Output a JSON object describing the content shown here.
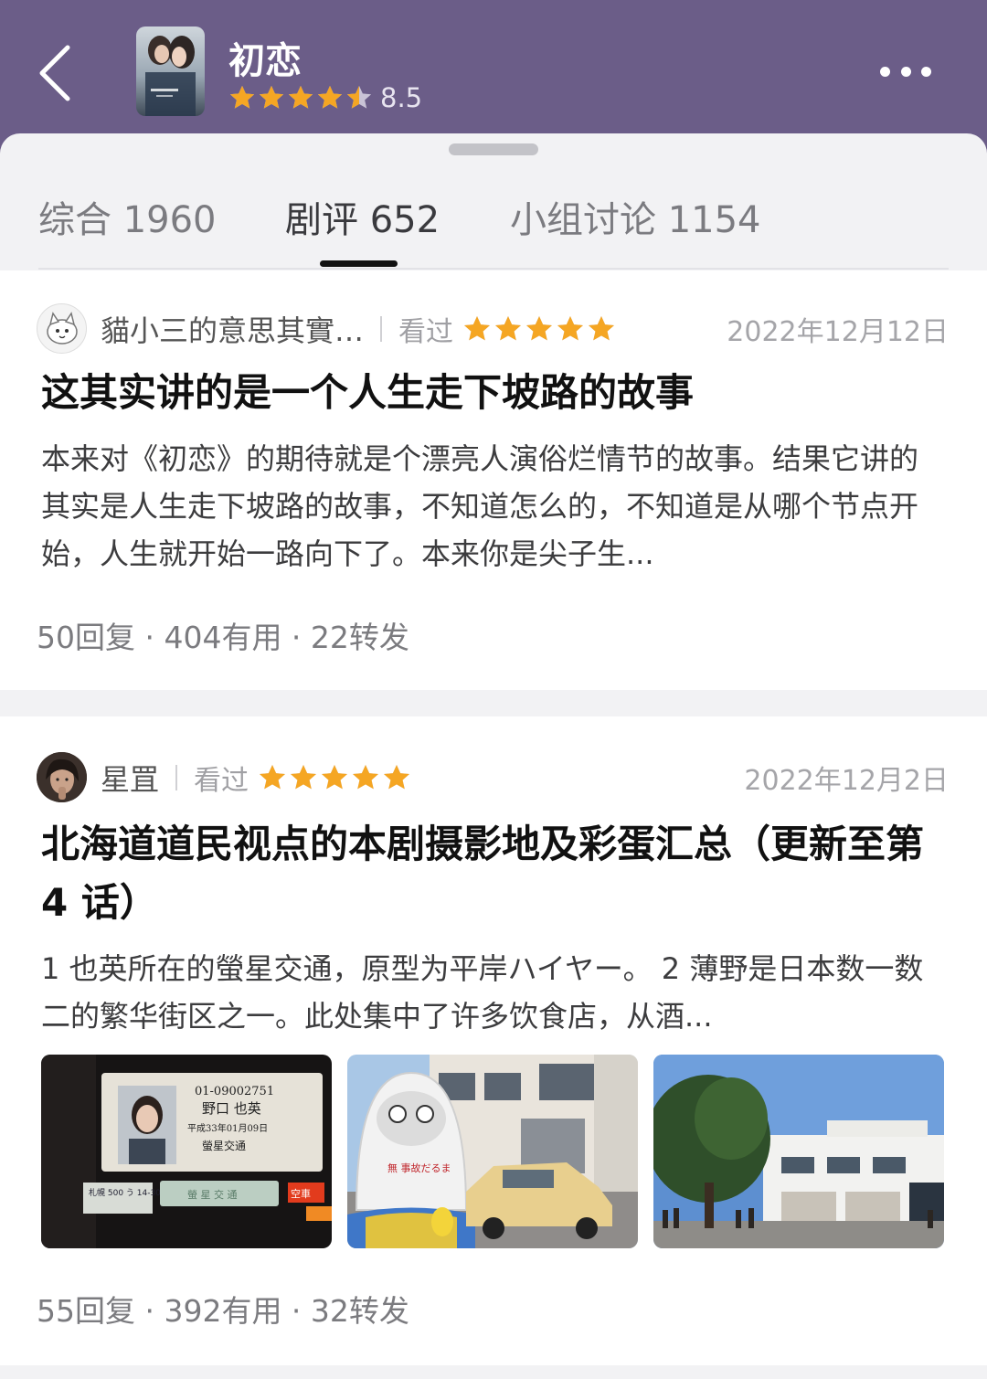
{
  "header": {
    "title": "初恋",
    "rating_value": "8.5",
    "rating_stars": 4.5,
    "back_icon": "chevron-left-icon",
    "more_icon": "more-dots-icon",
    "poster_caption": "First Love"
  },
  "tabs": [
    {
      "label": "综合 1960",
      "active": false
    },
    {
      "label": "剧评 652",
      "active": true
    },
    {
      "label": "小组讨论 1154",
      "active": false
    }
  ],
  "reviews": [
    {
      "username": "貓小三的意思其實…",
      "status": "看过",
      "stars": 5,
      "date": "2022年12月12日",
      "title": "这其实讲的是一个人生走下坡路的故事",
      "excerpt": "本来对《初恋》的期待就是个漂亮人演俗烂情节的故事。结果它讲的其实是人生走下坡路的故事，不知道怎么的，不知道是从哪个节点开始，人生就开始一路向下了。本来你是尖子生...",
      "stats": "50回复 · 404有用 · 22转发"
    },
    {
      "username": "星罝",
      "status": "看过",
      "stars": 5,
      "date": "2022年12月2日",
      "title": "北海道道民视点的本剧摄影地及彩蛋汇总（更新至第 4 话）",
      "excerpt": "1 也英所在的螢星交通，原型为平岸ハイヤー。 2 薄野是日本数一数二的繁华街区之一。此处集中了许多饮食店，从酒...",
      "stats": "55回复 · 392有用 · 32转发",
      "photos": {
        "license": {
          "number": "01-09002751",
          "name": "野口 也英",
          "date": "平成33年01月09日",
          "company": "螢星交通",
          "plate": "札幌 500 う 14-30",
          "sign": "螢 星 交 通",
          "vacant": "空車"
        },
        "daruma_text": "無 事故だるま"
      }
    }
  ],
  "colors": {
    "header_bg": "#6b5d88",
    "star": "#f5a623",
    "active_tab": "#111111"
  }
}
